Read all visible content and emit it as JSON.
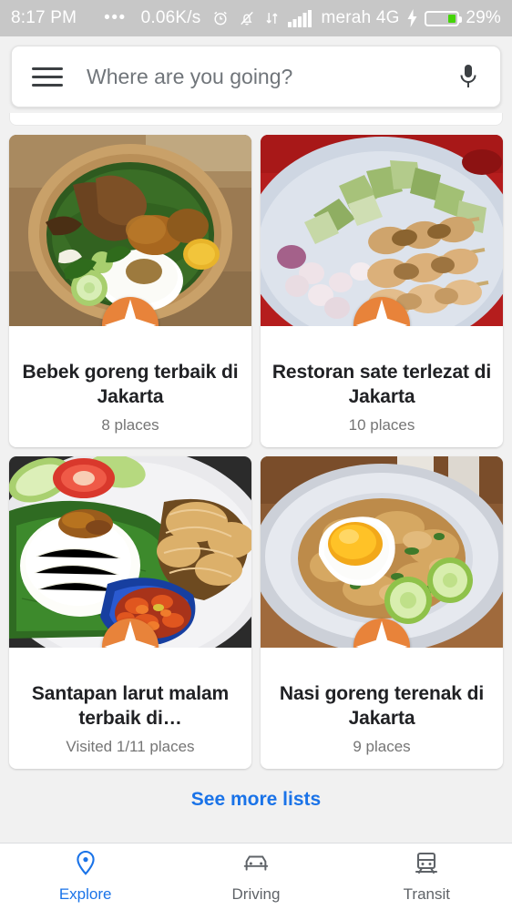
{
  "status_bar": {
    "time": "8:17 PM",
    "overflow_dots": "•••",
    "data_rate": "0.06K/s",
    "icons": [
      "alarm-icon",
      "bell-muted-icon",
      "data-transfer-icon",
      "signal-bars-icon"
    ],
    "carrier": "merah 4G",
    "charging": true,
    "battery_percent": "29%",
    "battery_level": 29,
    "background_color": "#c7c7c7",
    "text_color": "#ffffff",
    "battery_fill_color": "#45d408"
  },
  "search": {
    "placeholder": "Where are you going?",
    "value": "",
    "menu_icon": "hamburger-menu-icon",
    "mic_icon": "microphone-icon"
  },
  "cards": [
    {
      "title": "Bebek goreng terbaik di Jakarta",
      "subtitle": "8 places",
      "badge_icon": "sparkle-star-icon",
      "photo_alt": "fried duck with rice on banana leaf in woven basket"
    },
    {
      "title": "Restoran sate terlezat di Jakarta",
      "subtitle": "10 places",
      "badge_icon": "sparkle-star-icon",
      "photo_alt": "chicken satay skewers with lontong on white plate"
    },
    {
      "title": "Santapan larut malam terbaik di…",
      "subtitle": "Visited 1/11 places",
      "badge_icon": "sparkle-star-icon",
      "photo_alt": "rice with sambal in blue bowl and fried chicken"
    },
    {
      "title": "Nasi goreng terenak di Jakarta",
      "subtitle": "9 places",
      "badge_icon": "sparkle-star-icon",
      "photo_alt": "fried rice with sunny side up egg and cucumber"
    }
  ],
  "see_more": {
    "label": "See more lists",
    "color": "#1a73e8"
  },
  "bottom_nav": {
    "active_color": "#1a73e8",
    "inactive_color": "#5f6368",
    "items": [
      {
        "label": "Explore",
        "icon": "location-pin-icon",
        "active": true
      },
      {
        "label": "Driving",
        "icon": "car-icon",
        "active": false
      },
      {
        "label": "Transit",
        "icon": "train-icon",
        "active": false
      }
    ]
  },
  "theme": {
    "badge_orange": "#e8833a",
    "page_background": "#f1f1f1",
    "card_background": "#ffffff"
  }
}
